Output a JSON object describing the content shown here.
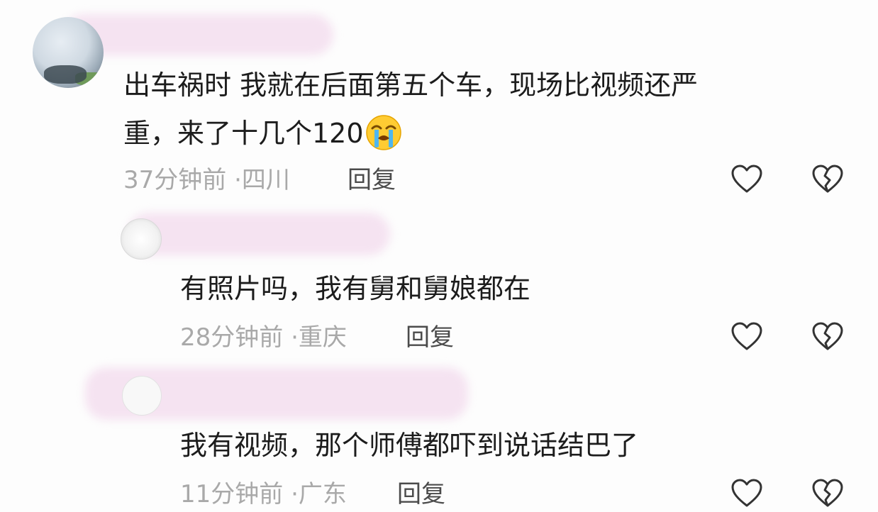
{
  "comments": [
    {
      "text_line1": "出车祸时  我就在后面第五个车，现场比视频还严",
      "text_line2": "重，来了十几个120",
      "emoji": "loudly-crying-face",
      "time": "37分钟前",
      "location": "四川",
      "reply_label": "回复"
    },
    {
      "text_line1": "有照片吗，我有舅和舅娘都在",
      "time": "28分钟前",
      "location": "重庆",
      "reply_label": "回复"
    },
    {
      "text_line1": "我有视频，那个师傅都吓到说话结巴了",
      "time": "11分钟前",
      "location": "广东",
      "reply_label": "回复"
    }
  ],
  "separator": "·",
  "icons": {
    "like": "heart-outline-icon",
    "dislike": "broken-heart-outline-icon"
  },
  "colors": {
    "background": "#fdfdfd",
    "text": "#1c1c1c",
    "meta": "#a9a9a9",
    "reply": "#4b4b4b",
    "redaction": "#f5e3f1"
  }
}
